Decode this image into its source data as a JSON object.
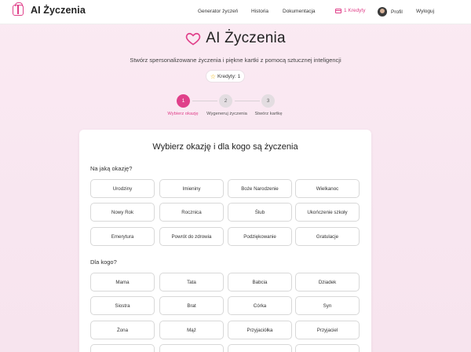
{
  "nav": {
    "brand": "AI Życzenia",
    "links": [
      "Generator życzeń",
      "Historia",
      "Dokumentacja"
    ],
    "credits": "1 Kredyty",
    "profile": "Profil",
    "logout": "Wyloguj"
  },
  "hero": {
    "title": "AI Życzenia",
    "subtitle": "Stwórz spersonalizowane życzenia i piękne kartki z pomocą sztucznej inteligencji",
    "credits_label": "Kredyty: 1"
  },
  "steps": [
    {
      "num": "1",
      "label": "Wybierz okazję",
      "active": true
    },
    {
      "num": "2",
      "label": "Wygeneruj życzenia",
      "active": false
    },
    {
      "num": "3",
      "label": "Stwórz kartkę",
      "active": false
    }
  ],
  "card": {
    "title": "Wybierz okazję i dla kogo są życzenia",
    "occasion_label": "Na jaką okazję?",
    "occasions": [
      "Urodziny",
      "Imieniny",
      "Boże Narodzenie",
      "Wielkanoc",
      "Nowy Rok",
      "Rocznica",
      "Ślub",
      "Ukończenie szkoły",
      "Emerytura",
      "Powrót do zdrowia",
      "Podziękowanie",
      "Gratulacje"
    ],
    "recipient_label": "Dla kogo?",
    "recipients": [
      "Mama",
      "Tata",
      "Babcia",
      "Dziadek",
      "Siostra",
      "Brat",
      "Córka",
      "Syn",
      "Żona",
      "Mąż",
      "Przyjaciółka",
      "Przyjaciel",
      "",
      "",
      "",
      ""
    ]
  },
  "colors": {
    "accent": "#e0408a",
    "background": "#fbeaf3"
  }
}
